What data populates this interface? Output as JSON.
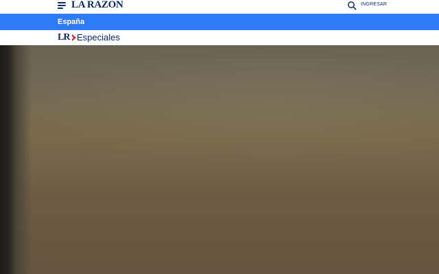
{
  "header": {
    "logo_text": "LA RAZÓN",
    "menu_icon": "hamburger-menu-icon",
    "search_icon": "search-icon",
    "login_label": "INGRESAR"
  },
  "section": {
    "title": "España",
    "color": "#2f7bf7"
  },
  "subheader": {
    "brand_mark": "LR",
    "brand_label": "Especiales",
    "chevron_color": "#d2232a"
  },
  "hero": {
    "description": "blurred image"
  },
  "colors": {
    "brand_navy": "#0a2a66",
    "accent_blue": "#2f7bf7"
  }
}
